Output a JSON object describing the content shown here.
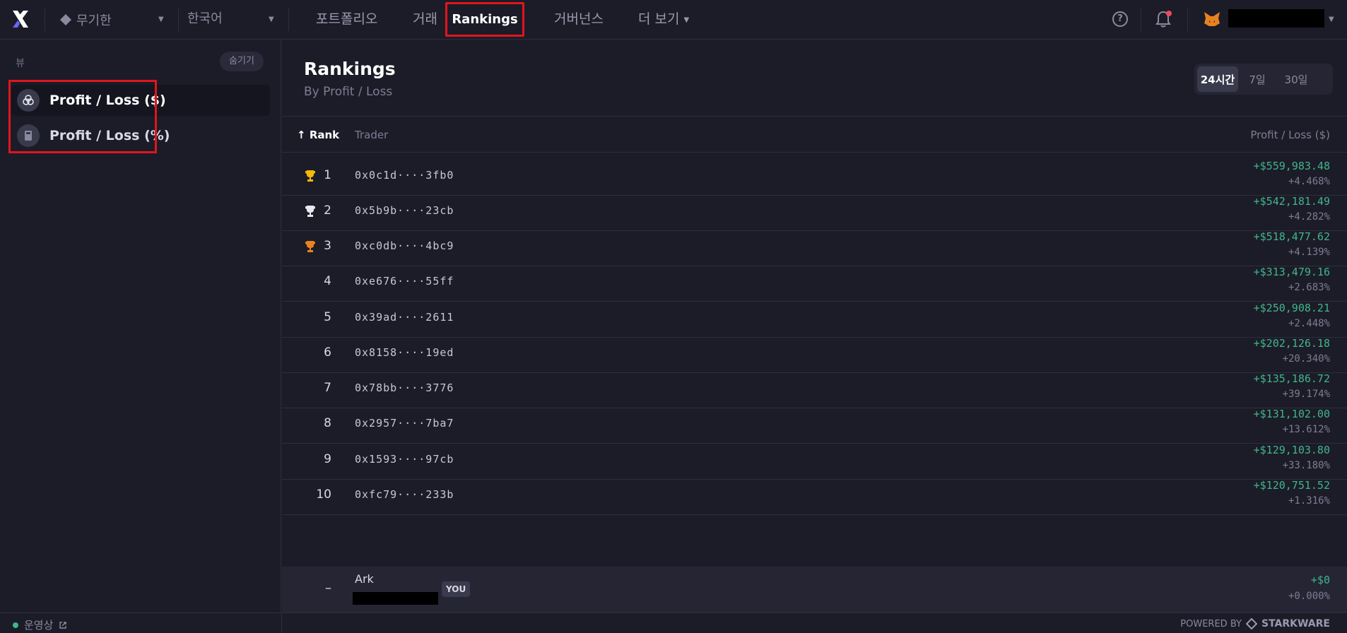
{
  "header": {
    "market": "무기한",
    "language": "한국어",
    "nav": [
      "포트폴리오",
      "거래",
      "Rankings",
      "거버넌스",
      "더 보기"
    ],
    "active_nav": "Rankings"
  },
  "sidebar": {
    "view_label": "뷰",
    "hide_button": "숨기기",
    "items": [
      {
        "label": "Profit / Loss ($)",
        "icon": "coins-icon",
        "selected": true
      },
      {
        "label": "Profit / Loss (%)",
        "icon": "calculator-icon",
        "selected": false
      }
    ]
  },
  "main": {
    "title": "Rankings",
    "subtitle": "By Profit / Loss",
    "time_ranges": [
      "24시간",
      "7일",
      "30일"
    ],
    "active_range": "24시간",
    "columns": {
      "rank": "Rank",
      "trader": "Trader",
      "pl": "Profit / Loss ($)"
    },
    "rows": [
      {
        "rank": "1",
        "trader": "0x0c1d····3fb0",
        "pl_usd": "+$559,983.48",
        "pl_pct": "+4.468%",
        "trophy": "gold"
      },
      {
        "rank": "2",
        "trader": "0x5b9b····23cb",
        "pl_usd": "+$542,181.49",
        "pl_pct": "+4.282%",
        "trophy": "silver"
      },
      {
        "rank": "3",
        "trader": "0xc0db····4bc9",
        "pl_usd": "+$518,477.62",
        "pl_pct": "+4.139%",
        "trophy": "bronze"
      },
      {
        "rank": "4",
        "trader": "0xe676····55ff",
        "pl_usd": "+$313,479.16",
        "pl_pct": "+2.683%"
      },
      {
        "rank": "5",
        "trader": "0x39ad····2611",
        "pl_usd": "+$250,908.21",
        "pl_pct": "+2.448%"
      },
      {
        "rank": "6",
        "trader": "0x8158····19ed",
        "pl_usd": "+$202,126.18",
        "pl_pct": "+20.340%"
      },
      {
        "rank": "7",
        "trader": "0x78bb····3776",
        "pl_usd": "+$135,186.72",
        "pl_pct": "+39.174%"
      },
      {
        "rank": "8",
        "trader": "0x2957····7ba7",
        "pl_usd": "+$131,102.00",
        "pl_pct": "+13.612%"
      },
      {
        "rank": "9",
        "trader": "0x1593····97cb",
        "pl_usd": "+$129,103.80",
        "pl_pct": "+33.180%"
      },
      {
        "rank": "10",
        "trader": "0xfc79····233b",
        "pl_usd": "+$120,751.52",
        "pl_pct": "+1.316%"
      }
    ],
    "you": {
      "rank": "–",
      "name": "Ark",
      "tag": "YOU",
      "pl_usd": "+$0",
      "pl_pct": "+0.000%"
    }
  },
  "footer": {
    "status": "운영상",
    "powered_by": "POWERED BY",
    "brand": "STARKWARE"
  },
  "colors": {
    "positive": "#3fb68b",
    "highlight_box": "#e0151d"
  }
}
